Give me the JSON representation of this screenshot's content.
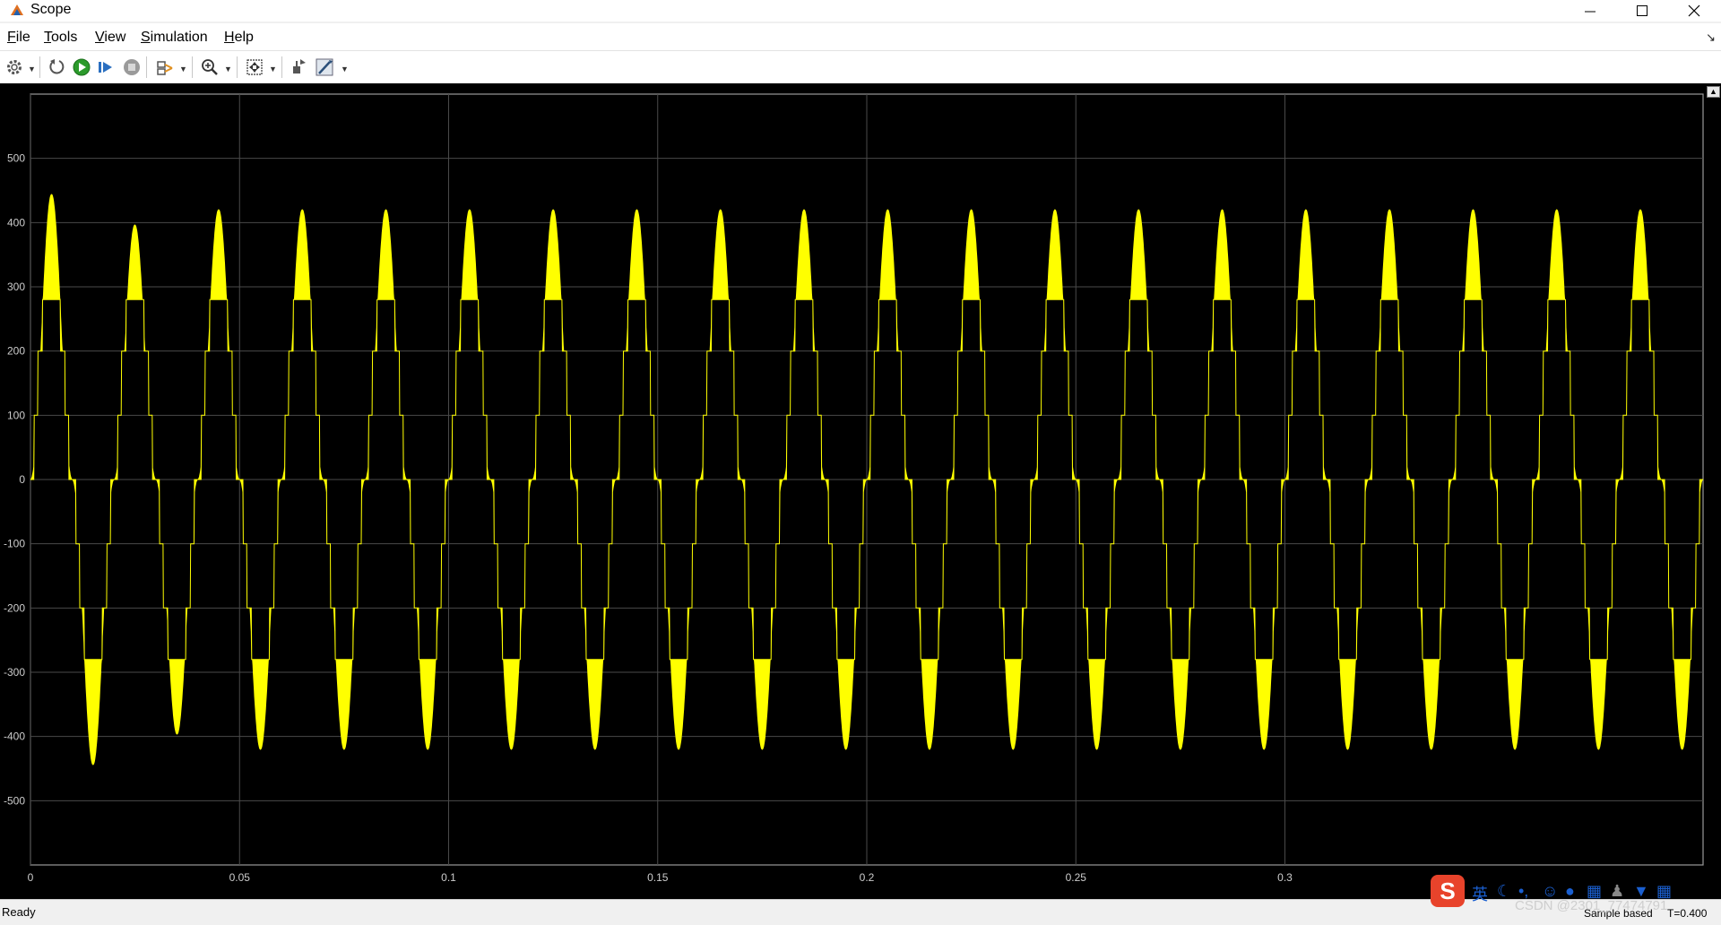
{
  "window": {
    "title": "Scope",
    "controls": [
      "minimize",
      "maximize",
      "close"
    ]
  },
  "menu": [
    {
      "label": "File",
      "mnemonic": "F",
      "rest": "ile"
    },
    {
      "label": "Tools",
      "mnemonic": "T",
      "rest": "ools"
    },
    {
      "label": "View",
      "mnemonic": "V",
      "rest": "iew"
    },
    {
      "label": "Simulation",
      "mnemonic": "S",
      "rest": "imulation"
    },
    {
      "label": "Help",
      "mnemonic": "H",
      "rest": "elp"
    }
  ],
  "toolbar": {
    "icons": [
      "settings-gear-icon",
      "step-back-icon",
      "run-icon",
      "step-forward-icon",
      "stop-icon",
      "signal-selection-icon",
      "zoom-in-icon",
      "autoscale-icon",
      "highlight-simulink-block-icon",
      "style-icon"
    ]
  },
  "colors": {
    "plot_background": "#000000",
    "signal": "#ffff00",
    "grid": "#4a4a4a",
    "tick_label": "#cccccc",
    "ime_brand": "#e8432b"
  },
  "status": {
    "text": "Ready",
    "sample_mode": "Sample based",
    "time_readout": "T=0.400"
  },
  "watermark": "CSDN @2301_77474791",
  "ime": {
    "brand": "S",
    "mode": "英"
  },
  "chart_data": {
    "type": "line",
    "title": "",
    "xlabel": "",
    "ylabel": "",
    "xlim": [
      0,
      0.4
    ],
    "ylim": [
      -600,
      600
    ],
    "xticks": [
      0,
      0.05,
      0.1,
      0.15,
      0.2,
      0.25,
      0.3
    ],
    "xtick_labels": [
      "0",
      "0.05",
      "0.1",
      "0.15",
      "0.2",
      "0.25",
      "0.3"
    ],
    "yticks": [
      500,
      400,
      300,
      200,
      100,
      0,
      -100,
      -200,
      -300,
      -400,
      -500
    ],
    "ytick_labels": [
      "500",
      "400",
      "300",
      "200",
      "100",
      "0",
      "-100",
      "-200",
      "-300",
      "-400",
      "-500"
    ],
    "grid": true,
    "series": [
      {
        "color": "#ffff00",
        "fundamental_hz": 50,
        "steady_state": {
          "description_levels": [
            0,
            100,
            200,
            300,
            420
          ],
          "peak_positive": 420,
          "peak_negative": -420,
          "inner_envelope_peak": 280,
          "inner_envelope_trough": -280
        },
        "startup_peaks": [
          {
            "t": 0.005,
            "value": 330
          },
          {
            "t": 0.015,
            "value": -450
          },
          {
            "t": 0.025,
            "value": 455
          },
          {
            "t": 0.035,
            "value": -435
          }
        ]
      }
    ]
  }
}
